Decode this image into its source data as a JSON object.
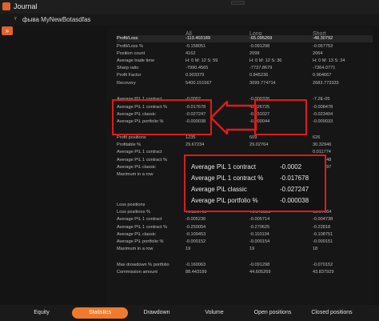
{
  "window": {
    "title": "Journal"
  },
  "account": {
    "icon": "user-icon",
    "name": "фыва MyNewBotasdfas"
  },
  "columns": [
    "All",
    "Long",
    "Short"
  ],
  "rows": [
    {
      "label": "Profit/Loss",
      "all": "-113.403189",
      "long": "-65.095269",
      "short": "-48.30792",
      "highlight": true
    },
    {
      "label": "Profit/Loss %",
      "all": "-0.158051",
      "long": "-0.091298",
      "short": "-0.067753"
    },
    {
      "label": "Position count",
      "all": "4162",
      "long": "2098",
      "short": "2064"
    },
    {
      "label": "Average trade time",
      "all": "H: 0 M: 12 S: 59",
      "long": "H: 0 M: 12 S: 36",
      "short": "H: 0 M: 13 S: 24"
    },
    {
      "label": "Sharp ratio",
      "all": "-7990.4565",
      "long": "-7737.8679",
      "short": "-7364.0771"
    },
    {
      "label": "Profit Factor",
      "all": "0.903379",
      "long": "0.845236",
      "short": "0.964667"
    },
    {
      "label": "Recovery",
      "all": "5400.151567",
      "long": "3099.774714",
      "short": "2683.773333"
    },
    {
      "label": "Average P\\L 1 contract",
      "all": "-0.0002",
      "long": "-0.000326",
      "short": "-7.2E-05"
    },
    {
      "label": "Average P\\L 1 contract %",
      "all": "-0.017678",
      "long": "-0.026725",
      "short": "-0.008478"
    },
    {
      "label": "Average P\\L classic",
      "all": "-0.027247",
      "long": "-0.031027",
      "short": "-0.023404"
    },
    {
      "label": "Average P\\L portfolio %",
      "all": "-0.000038",
      "long": "-0.000044",
      "short": "-0.000033"
    },
    {
      "label": "Profit positions",
      "all": "1235",
      "long": "609",
      "short": "626"
    },
    {
      "label": "Profitable %",
      "all": "29.67234",
      "long": "29.02764",
      "short": "30.32946"
    },
    {
      "label": "Average P\\L 1 contract",
      "all": "",
      "long": "",
      "short": "0.011774"
    },
    {
      "label": "Average P\\L 1 contract %",
      "all": "",
      "long": "",
      "short": "0.004948"
    },
    {
      "label": "Average P\\L classic",
      "all": "",
      "long": "",
      "short": "0.031497"
    },
    {
      "label": "Maximum in a row",
      "all": "",
      "long": "",
      "short": "4"
    },
    {
      "label": "Loss positions",
      "all": "",
      "long": "",
      "short": ""
    },
    {
      "label": "Loss positions %",
      "all": "70.326768",
      "long": "70.972355",
      "short": "69.67064"
    },
    {
      "label": "Average P\\L 1 contract",
      "all": "-0.005236",
      "long": "-0.005714",
      "short": "-0.004738"
    },
    {
      "label": "Average P\\L 1 contract %",
      "all": "-0.250054",
      "long": "-0.270625",
      "short": "-0.22818"
    },
    {
      "label": "Average P\\L classic",
      "all": "-0.109453",
      "long": "-0.110134",
      "short": "-0.108751"
    },
    {
      "label": "Average P\\L portfolio %",
      "all": "-0.000152",
      "long": "-0.000154",
      "short": "-0.000151"
    },
    {
      "label": "Maximum in a row",
      "all": "19",
      "long": "19",
      "short": "18"
    },
    {
      "label": "Max drowdown % portfolio",
      "all": "-0.160063",
      "long": "-0.091298",
      "short": "-0.070152"
    },
    {
      "label": "Commission amount",
      "all": "88.443189",
      "long": "44.605269",
      "short": "43.837929"
    }
  ],
  "callout": {
    "rows": [
      {
        "label": "Average P\\L 1 contract",
        "value": "-0.0002"
      },
      {
        "label": "Average P\\L 1 contract %",
        "value": "-0.017678"
      },
      {
        "label": "Average P\\L classic",
        "value": "-0.027247"
      },
      {
        "label": "Average P\\L portfolio %",
        "value": "-0.000038"
      }
    ]
  },
  "tabs": [
    {
      "label": "Equity",
      "active": false
    },
    {
      "label": "Statistics",
      "active": true
    },
    {
      "label": "Drawdown",
      "active": false
    },
    {
      "label": "Volume",
      "active": false
    },
    {
      "label": "Open positions",
      "active": false
    },
    {
      "label": "Closed positions",
      "active": false
    }
  ],
  "colors": {
    "accent": "#f07a2c",
    "annotation": "#e01a1a",
    "background": "#141414"
  }
}
